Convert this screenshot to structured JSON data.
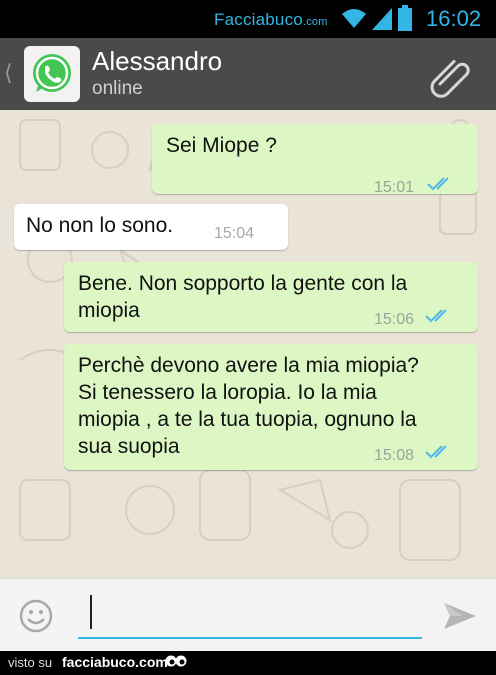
{
  "status_bar": {
    "watermark": "Facciabuco",
    "watermark_suffix": ".com",
    "time": "16:02",
    "icons": [
      "wifi-icon",
      "signal-icon",
      "battery-icon"
    ],
    "accent": "#33b5e5"
  },
  "header": {
    "contact_name": "Alessandro",
    "status": "online",
    "icons": [
      "back-icon",
      "whatsapp-icon",
      "attach-icon"
    ],
    "background": "#4a4a4a"
  },
  "messages": [
    {
      "direction": "out",
      "text": "Sei Miope ?",
      "time": "15:01",
      "read": true
    },
    {
      "direction": "in",
      "text": "No non lo sono.",
      "time": "15:04"
    },
    {
      "direction": "out",
      "lines": [
        "Bene. Non sopporto la gente con la",
        "miopia"
      ],
      "time": "15:06",
      "read": true
    },
    {
      "direction": "out",
      "lines": [
        "Perchè devono avere la mia miopia?",
        "Si tenessero la loropia. Io la mia",
        "miopia , a te la tua tuopia, ognuno la",
        "sua suopia"
      ],
      "time": "15:08",
      "read": true
    }
  ],
  "composer": {
    "value": "",
    "icons": [
      "emoji-icon",
      "send-icon"
    ]
  },
  "footer": {
    "prefix": "visto su",
    "site": "facciabuco.com"
  },
  "colors": {
    "outgoing_bubble": "#dcf7c4",
    "incoming_bubble": "#ffffff",
    "chat_background": "#e9e3d8",
    "read_ticks": "#4fb8e8"
  }
}
